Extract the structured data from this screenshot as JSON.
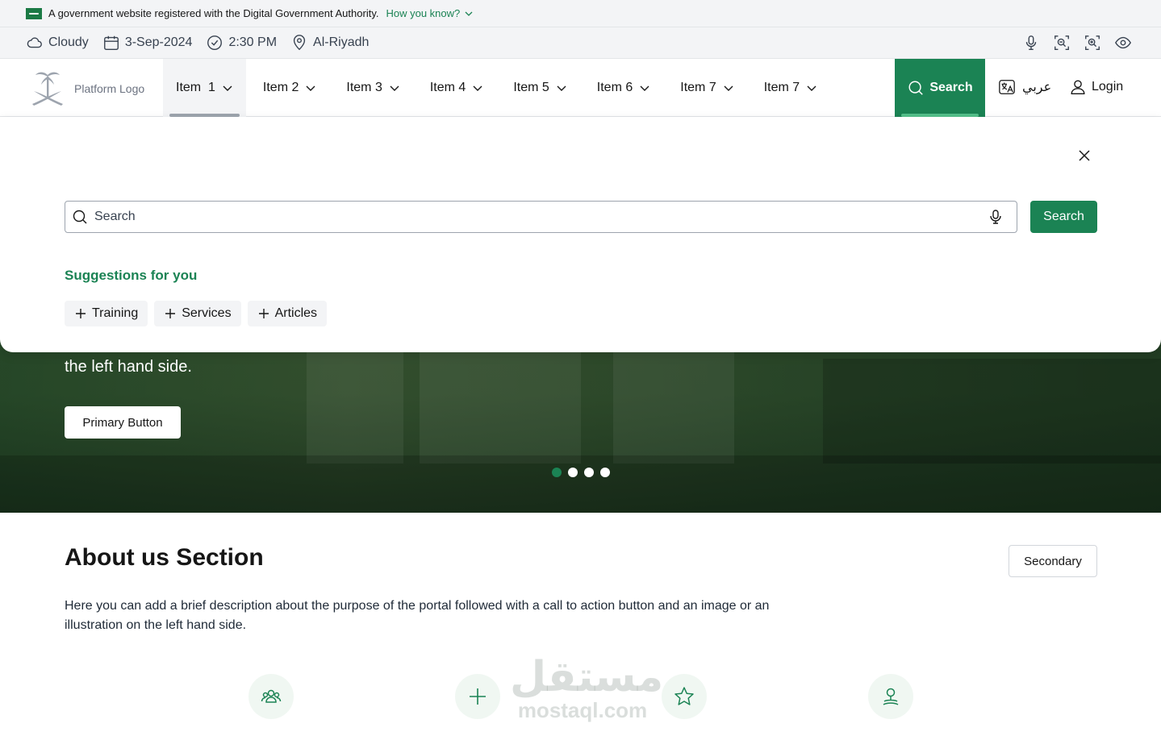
{
  "gov_banner": {
    "text": "A government website registered with the Digital Government Authority.",
    "link": "How you know?"
  },
  "info_bar": {
    "weather": "Cloudy",
    "date": "3-Sep-2024",
    "time": "2:30 PM",
    "location": "Al-Riyadh",
    "tool_icons": [
      "microphone-icon",
      "zoom-out-icon",
      "zoom-in-icon",
      "eye-icon"
    ]
  },
  "nav": {
    "logo_text": "Platform Logo",
    "items": [
      {
        "label": "Item  1"
      },
      {
        "label": "Item 2"
      },
      {
        "label": "Item 3"
      },
      {
        "label": "Item 4"
      },
      {
        "label": "Item 5"
      },
      {
        "label": "Item 6"
      },
      {
        "label": "Item 7"
      },
      {
        "label": "Item 7"
      }
    ],
    "search_label": "Search",
    "lang_label": "عربي",
    "login_label": "Login"
  },
  "search_panel": {
    "placeholder": "Search",
    "submit_label": "Search",
    "suggestions_title": "Suggestions for you",
    "chips": [
      {
        "label": "Training"
      },
      {
        "label": "Services"
      },
      {
        "label": "Articles"
      }
    ]
  },
  "hero": {
    "text_visible": "the left hand side.",
    "button_label": "Primary Button",
    "slides_count": 4,
    "active_slide": 1
  },
  "about": {
    "title": "About us Section",
    "secondary_label": "Secondary",
    "description": "Here you can add a brief description about the purpose of the portal followed with a call to action button and an image or an illustration on the left hand side."
  },
  "features": {
    "icons": [
      "people-icon",
      "plus-icon",
      "star-icon",
      "location-pin-icon"
    ]
  },
  "watermark": {
    "arabic": "مستقل",
    "latin": "mostaql.com"
  },
  "colors": {
    "primary": "#1b8354",
    "primary_light": "#f0f7f2",
    "gray_bg": "#f3f4f6",
    "text": "#161616"
  }
}
